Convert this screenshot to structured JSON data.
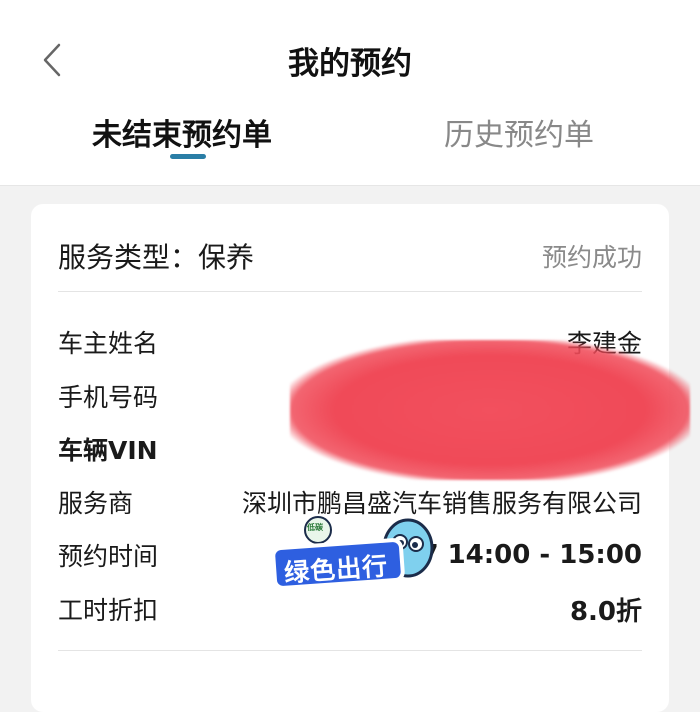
{
  "header": {
    "title": "我的预约",
    "back_icon": "chevron-left-icon"
  },
  "tabs": [
    {
      "label": "未结束预约单",
      "active": true
    },
    {
      "label": "历史预约单",
      "active": false
    }
  ],
  "colors": {
    "accent": "#2a7ea6",
    "background": "#f2f2f2",
    "redaction": "#f04a58"
  },
  "card": {
    "service_type": "服务类型：保养",
    "status": "预约成功",
    "rows": [
      {
        "label": "车主姓名",
        "value": "李建金"
      },
      {
        "label": "手机号码",
        "value": ""
      },
      {
        "label": "车辆VIN",
        "value": ""
      },
      {
        "label": "服务商",
        "value": "深圳市鹏昌盛汽车销售服务有限公司"
      },
      {
        "label": "预约时间",
        "value": "7 14:00 - 15:00"
      },
      {
        "label": "工时折扣",
        "value": "8.0折"
      }
    ]
  },
  "sticker": {
    "text": "绿色出行",
    "badge": "低碳"
  }
}
